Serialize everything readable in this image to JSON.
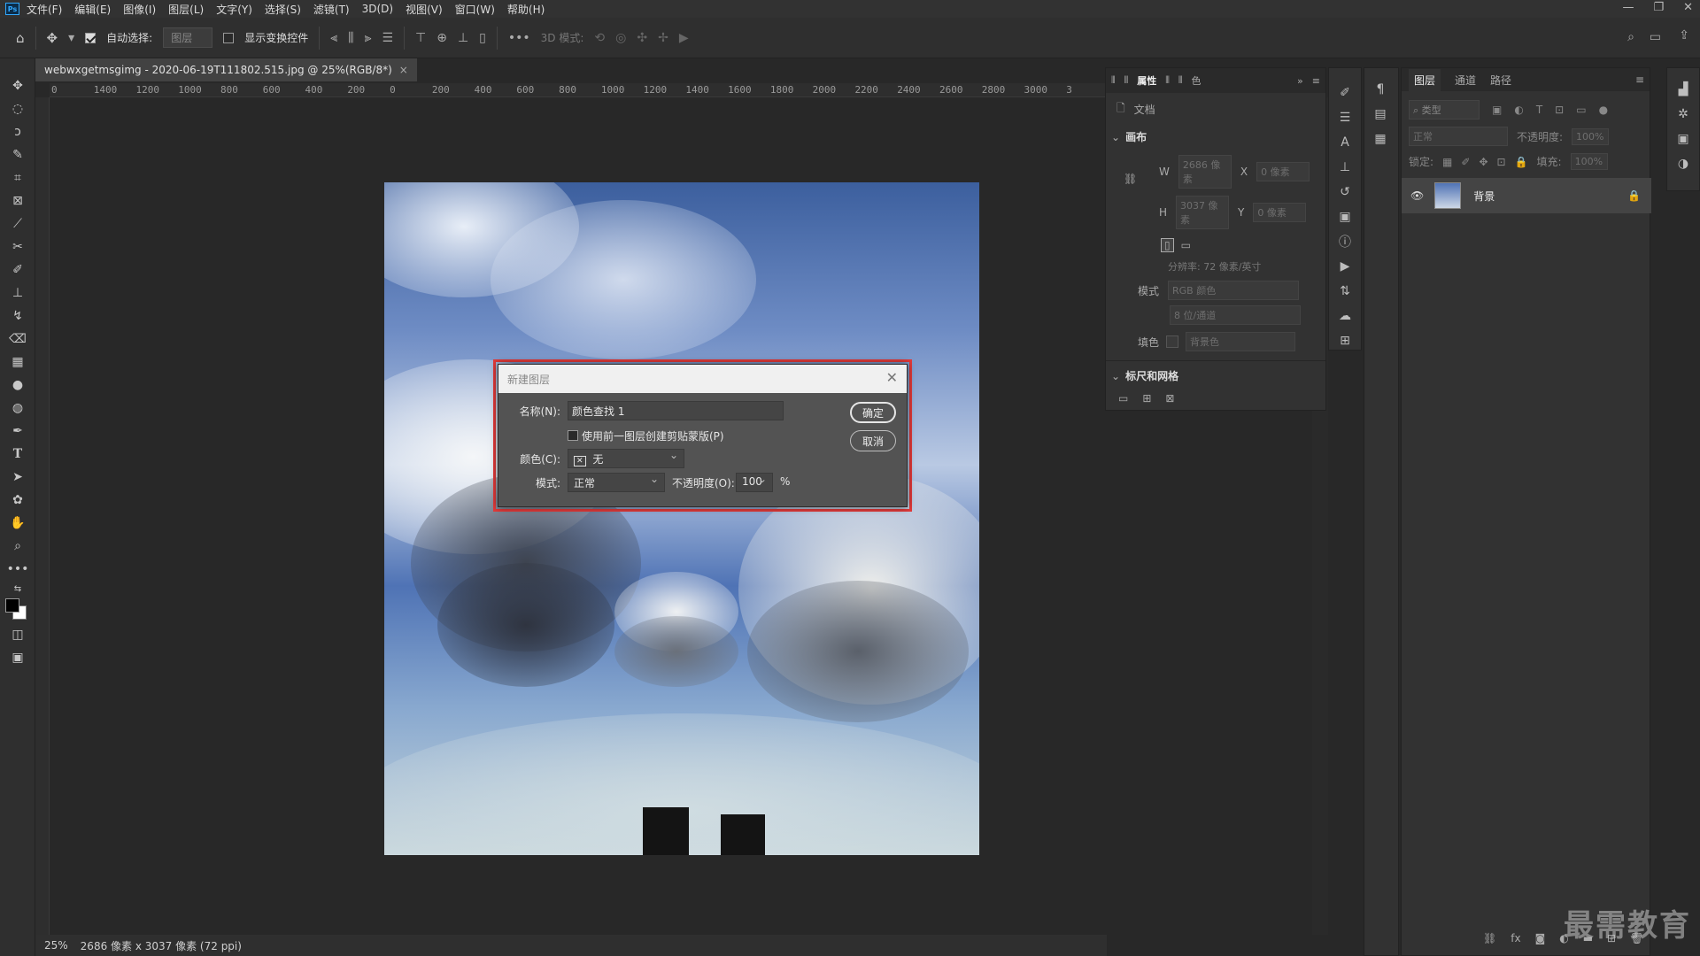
{
  "menubar": {
    "logo": "Ps",
    "items": [
      "文件(F)",
      "编辑(E)",
      "图像(I)",
      "图层(L)",
      "文字(Y)",
      "选择(S)",
      "滤镜(T)",
      "3D(D)",
      "视图(V)",
      "窗口(W)",
      "帮助(H)"
    ]
  },
  "options": {
    "auto_select_label": "自动选择:",
    "auto_select_value": "图层",
    "show_transform_label": "显示变换控件",
    "mode3d_label": "3D 模式:"
  },
  "document": {
    "tab_title": "webwxgetmsgimg - 2020-06-19T111802.515.jpg @ 25%(RGB/8*)",
    "ruler_ticks": [
      "0",
      "1400",
      "1200",
      "1000",
      "800",
      "600",
      "400",
      "200",
      "0",
      "200",
      "400",
      "600",
      "800",
      "1000",
      "1200",
      "1400",
      "1600",
      "1800",
      "2000",
      "2200",
      "2400",
      "2600",
      "2800",
      "3000",
      "3"
    ]
  },
  "status": {
    "zoom": "25%",
    "doc_info": "2686 像素 x 3037 像素 (72 ppi)"
  },
  "properties": {
    "tab_label": "属性",
    "tab_color": "色",
    "doc_label": "文档",
    "canvas_section": "画布",
    "w_label": "W",
    "w_value": "2686 像素",
    "h_label": "H",
    "h_value": "3037 像素",
    "x_label": "X",
    "x_value": "0 像素",
    "y_label": "Y",
    "y_value": "0 像素",
    "resolution": "分辨率: 72 像素/英寸",
    "mode_label": "模式",
    "mode_value": "RGB 颜色",
    "depth_value": "8 位/通道",
    "fill_label": "填色",
    "fill_value": "背景色",
    "rulers_section": "标尺和网格"
  },
  "layers": {
    "tabs": [
      "图层",
      "通道",
      "路径"
    ],
    "filter_placeholder": "类型",
    "blend_mode": "正常",
    "opacity_label": "不透明度:",
    "opacity_value": "100%",
    "lock_label": "锁定:",
    "fill_label": "填充:",
    "fill_value": "100%",
    "items": [
      {
        "name": "背景"
      }
    ]
  },
  "dialog": {
    "title": "新建图层",
    "name_label": "名称(N):",
    "name_value": "颜色查找 1",
    "clip_label": "使用前一图层创建剪贴蒙版(P)",
    "color_label": "颜色(C):",
    "color_value": "无",
    "mode_label": "模式:",
    "mode_value": "正常",
    "opacity_label": "不透明度(O):",
    "opacity_value": "100",
    "percent": "%",
    "ok_label": "确定",
    "cancel_label": "取消"
  },
  "watermark": "最需教育",
  "colors": {
    "highlight_border": "#e23a3a",
    "accent": "#31a8ff"
  }
}
